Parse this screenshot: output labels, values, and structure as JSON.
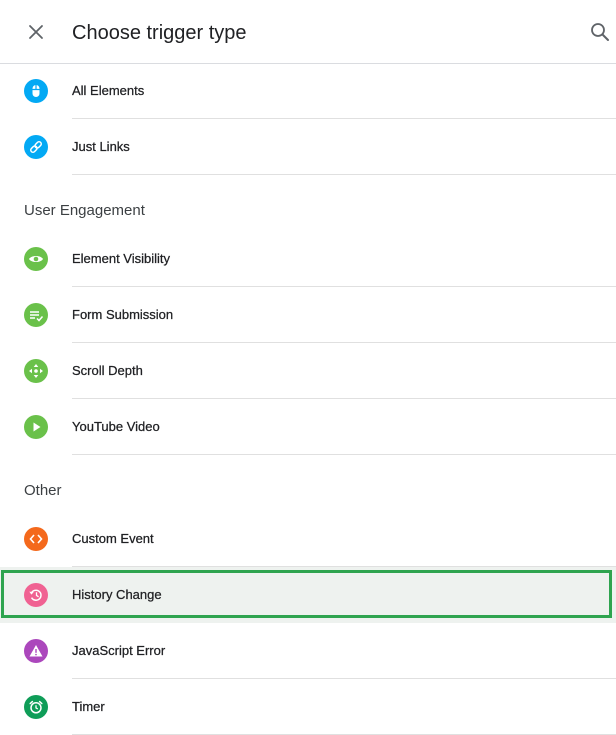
{
  "header": {
    "title": "Choose trigger type",
    "close_icon": "close-icon",
    "search_icon": "search-icon"
  },
  "colors": {
    "click_blue": "#03a9f4",
    "engagement_green": "#6ac14a",
    "custom_event_orange": "#f4691c",
    "history_pink": "#f06292",
    "js_error_purple": "#ab47bc",
    "timer_green": "#0f9d58",
    "highlight_border": "#2ea44f"
  },
  "groups": [
    {
      "items": [
        {
          "label": "All Elements",
          "icon": "mouse-icon"
        },
        {
          "label": "Just Links",
          "icon": "link-icon"
        }
      ]
    },
    {
      "title": "User Engagement",
      "items": [
        {
          "label": "Element Visibility",
          "icon": "eye-icon"
        },
        {
          "label": "Form Submission",
          "icon": "form-check-icon"
        },
        {
          "label": "Scroll Depth",
          "icon": "scroll-arrows-icon"
        },
        {
          "label": "YouTube Video",
          "icon": "play-icon"
        }
      ]
    },
    {
      "title": "Other",
      "items": [
        {
          "label": "Custom Event",
          "icon": "code-brackets-icon"
        },
        {
          "label": "History Change",
          "icon": "history-icon",
          "highlighted": true
        },
        {
          "label": "JavaScript Error",
          "icon": "warning-icon"
        },
        {
          "label": "Timer",
          "icon": "alarm-clock-icon"
        }
      ]
    }
  ]
}
